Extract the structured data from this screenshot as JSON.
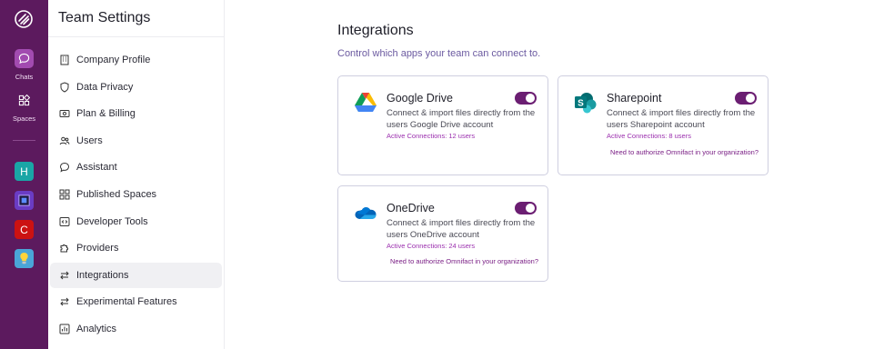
{
  "rail": {
    "chats_label": "Chats",
    "spaces_label": "Spaces",
    "spaces": [
      {
        "letter": "H",
        "color": "#1aa6a6"
      },
      {
        "letter": "",
        "color": "#6a3cc4"
      },
      {
        "letter": "C",
        "color": "#cc1212"
      },
      {
        "letter": "",
        "color": "#4aa5d8"
      }
    ]
  },
  "sidebar": {
    "title": "Team Settings",
    "items": [
      {
        "label": "Company Profile",
        "icon": "building-icon"
      },
      {
        "label": "Data Privacy",
        "icon": "shield-icon"
      },
      {
        "label": "Plan & Billing",
        "icon": "billing-icon"
      },
      {
        "label": "Users",
        "icon": "users-icon"
      },
      {
        "label": "Assistant",
        "icon": "chat-icon"
      },
      {
        "label": "Published Spaces",
        "icon": "spaces-icon"
      },
      {
        "label": "Developer Tools",
        "icon": "code-icon"
      },
      {
        "label": "Providers",
        "icon": "puzzle-icon"
      },
      {
        "label": "Integrations",
        "icon": "arrows-icon",
        "selected": true
      },
      {
        "label": "Experimental Features",
        "icon": "arrows-icon"
      },
      {
        "label": "Analytics",
        "icon": "chart-icon"
      }
    ]
  },
  "main": {
    "title": "Integrations",
    "subtitle": "Control which apps your team can connect to.",
    "cards": [
      {
        "name": "Google Drive",
        "description": "Connect & import files directly from the users Google Drive account",
        "connections": "Active Connections: 12 users",
        "enabled": true
      },
      {
        "name": "Sharepoint",
        "description": "Connect & import files directly from the users Sharepoint account",
        "connections": "Active Connections: 8 users",
        "auth_link": "Need to authorize Omnifact in your organization?",
        "enabled": true
      },
      {
        "name": "OneDrive",
        "description": "Connect & import files directly from the users OneDrive account",
        "connections": "Active Connections: 24 users",
        "auth_link": "Need to authorize Omnifact in your organization?",
        "enabled": true
      }
    ]
  }
}
